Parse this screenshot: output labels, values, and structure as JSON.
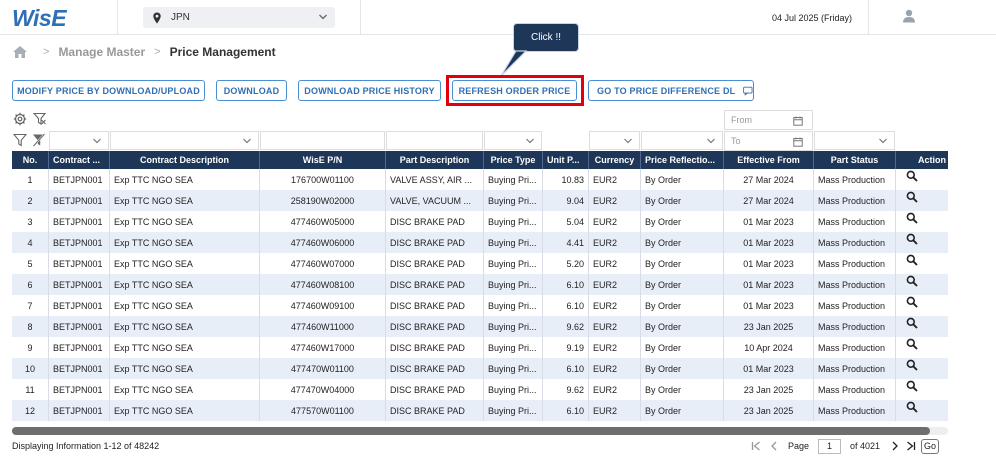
{
  "app": {
    "logo": "WisE"
  },
  "header": {
    "region": "JPN",
    "date": "04 Jul 2025 (Friday)"
  },
  "breadcrumb": {
    "items": [
      "Manage Master",
      "Price Management"
    ]
  },
  "tooltip": {
    "text": "Click !!"
  },
  "toolbar": {
    "modify_label": "MODIFY PRICE BY DOWNLOAD/UPLOAD",
    "download_label": "DOWNLOAD",
    "history_label": "DOWNLOAD PRICE HISTORY",
    "refresh_label": "REFRESH ORDER PRICE",
    "diff_label": "GO TO PRICE DIFFERENCE DL"
  },
  "date_filter": {
    "from_placeholder": "From",
    "to_placeholder": "To"
  },
  "table": {
    "columns": [
      "No.",
      "Contract ...",
      "Contract Description",
      "WisE P/N",
      "Part Description",
      "Price Type",
      "Unit P...",
      "Currency",
      "Price Reflectio...",
      "Effective From",
      "Part Status",
      "Action"
    ],
    "rows": [
      {
        "no": "1",
        "contract": "BETJPN001",
        "desc": "Exp TTC NGO SEA",
        "pn": "176700W01100",
        "part": "VALVE ASSY, AIR ...",
        "ptype": "Buying Pri...",
        "unit": "10.83",
        "cur": "EUR2",
        "refl": "By Order",
        "eff": "27 Mar 2024",
        "status": "Mass Production"
      },
      {
        "no": "2",
        "contract": "BETJPN001",
        "desc": "Exp TTC NGO SEA",
        "pn": "258190W02000",
        "part": "VALVE, VACUUM ...",
        "ptype": "Buying Pri...",
        "unit": "9.04",
        "cur": "EUR2",
        "refl": "By Order",
        "eff": "27 Mar 2024",
        "status": "Mass Production"
      },
      {
        "no": "3",
        "contract": "BETJPN001",
        "desc": "Exp TTC NGO SEA",
        "pn": "477460W05000",
        "part": "DISC BRAKE PAD",
        "ptype": "Buying Pri...",
        "unit": "5.04",
        "cur": "EUR2",
        "refl": "By Order",
        "eff": "01 Mar 2023",
        "status": "Mass Production"
      },
      {
        "no": "4",
        "contract": "BETJPN001",
        "desc": "Exp TTC NGO SEA",
        "pn": "477460W06000",
        "part": "DISC BRAKE PAD",
        "ptype": "Buying Pri...",
        "unit": "4.41",
        "cur": "EUR2",
        "refl": "By Order",
        "eff": "01 Mar 2023",
        "status": "Mass Production"
      },
      {
        "no": "5",
        "contract": "BETJPN001",
        "desc": "Exp TTC NGO SEA",
        "pn": "477460W07000",
        "part": "DISC BRAKE PAD",
        "ptype": "Buying Pri...",
        "unit": "5.20",
        "cur": "EUR2",
        "refl": "By Order",
        "eff": "01 Mar 2023",
        "status": "Mass Production"
      },
      {
        "no": "6",
        "contract": "BETJPN001",
        "desc": "Exp TTC NGO SEA",
        "pn": "477460W08100",
        "part": "DISC BRAKE PAD",
        "ptype": "Buying Pri...",
        "unit": "6.10",
        "cur": "EUR2",
        "refl": "By Order",
        "eff": "01 Mar 2023",
        "status": "Mass Production"
      },
      {
        "no": "7",
        "contract": "BETJPN001",
        "desc": "Exp TTC NGO SEA",
        "pn": "477460W09100",
        "part": "DISC BRAKE PAD",
        "ptype": "Buying Pri...",
        "unit": "6.10",
        "cur": "EUR2",
        "refl": "By Order",
        "eff": "01 Mar 2023",
        "status": "Mass Production"
      },
      {
        "no": "8",
        "contract": "BETJPN001",
        "desc": "Exp TTC NGO SEA",
        "pn": "477460W11000",
        "part": "DISC BRAKE PAD",
        "ptype": "Buying Pri...",
        "unit": "9.62",
        "cur": "EUR2",
        "refl": "By Order",
        "eff": "23 Jan 2025",
        "status": "Mass Production"
      },
      {
        "no": "9",
        "contract": "BETJPN001",
        "desc": "Exp TTC NGO SEA",
        "pn": "477460W17000",
        "part": "DISC BRAKE PAD",
        "ptype": "Buying Pri...",
        "unit": "9.19",
        "cur": "EUR2",
        "refl": "By Order",
        "eff": "10 Apr 2024",
        "status": "Mass Production"
      },
      {
        "no": "10",
        "contract": "BETJPN001",
        "desc": "Exp TTC NGO SEA",
        "pn": "477470W01100",
        "part": "DISC BRAKE PAD",
        "ptype": "Buying Pri...",
        "unit": "6.10",
        "cur": "EUR2",
        "refl": "By Order",
        "eff": "01 Mar 2023",
        "status": "Mass Production"
      },
      {
        "no": "11",
        "contract": "BETJPN001",
        "desc": "Exp TTC NGO SEA",
        "pn": "477470W04000",
        "part": "DISC BRAKE PAD",
        "ptype": "Buying Pri...",
        "unit": "9.62",
        "cur": "EUR2",
        "refl": "By Order",
        "eff": "23 Jan 2025",
        "status": "Mass Production"
      },
      {
        "no": "12",
        "contract": "BETJPN001",
        "desc": "Exp TTC NGO SEA",
        "pn": "477570W01100",
        "part": "DISC BRAKE PAD",
        "ptype": "Buying Pri...",
        "unit": "6.10",
        "cur": "EUR2",
        "refl": "By Order",
        "eff": "23 Jan 2025",
        "status": "Mass Production"
      }
    ]
  },
  "footer": {
    "display_text": "Displaying Information 1-12 of 48242",
    "page_label": "Page",
    "page_value": "1",
    "page_total": "of 4021",
    "go_label": "Go"
  },
  "colors": {
    "header_bg": "#1e3658",
    "accent": "#2f6fb5",
    "highlight": "#e0000f",
    "alt_row": "#e8eef8"
  }
}
